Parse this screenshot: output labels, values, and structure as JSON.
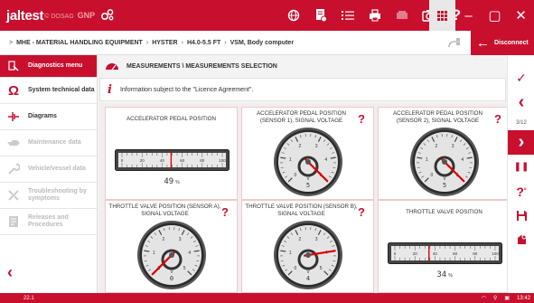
{
  "app": {
    "logo": "jaltest",
    "logo_sub": "© DOSAG",
    "logo_ext": "GNP"
  },
  "toolbar": {
    "icons": [
      "globe-icon",
      "report-icon",
      "list-icon",
      "print-icon",
      "printer-icon",
      "camera-icon",
      "help-icon"
    ],
    "window_grid": "apps-grid-icon",
    "minimize": "–",
    "maximize": "▢",
    "close": "✕"
  },
  "breadcrumb": {
    "items": [
      "MHE - MATERIAL HANDLING EQUIPMENT",
      "HYSTER",
      "H4.0-5.5 FT",
      "VSM, Body computer"
    ],
    "separator": "›",
    "home": ">"
  },
  "disconnect": {
    "label": "Disconnect",
    "arrow": "←"
  },
  "sidebar": {
    "items": [
      {
        "label": "Diagnostics menu",
        "icon": "diagnostics-icon",
        "state": "active"
      },
      {
        "label": "System technical data",
        "icon": "ohm-icon",
        "state": "normal"
      },
      {
        "label": "Diagrams",
        "icon": "diagram-icon",
        "state": "normal"
      },
      {
        "label": "Maintenance data",
        "icon": "oil-can-icon",
        "state": "disabled"
      },
      {
        "label": "Vehicle/vessel data",
        "icon": "wrench-icon",
        "state": "disabled"
      },
      {
        "label": "Troubleshooting by symptoms",
        "icon": "tools-icon",
        "state": "disabled"
      },
      {
        "label": "Releases and Procedures",
        "icon": "document-icon",
        "state": "disabled"
      }
    ],
    "back": "‹"
  },
  "section": {
    "title": "MEASUREMENTS \\ MEASUREMENTS SELECTION",
    "info": "Information subject to the \"Licence Agreement\".",
    "info_icon": "i"
  },
  "panels": [
    {
      "title": "ACCELERATOR PEDAL POSITION",
      "type": "linear",
      "value": "49",
      "unit": "%",
      "level": 49,
      "help": false,
      "ticks": [
        "0",
        "20",
        "40",
        "60",
        "80",
        "100"
      ]
    },
    {
      "title": "ACCELERATOR PEDAL POSITION (SENSOR 1), SIGNAL VOLTAGE",
      "type": "round",
      "value": "5",
      "unit": "V",
      "level": 5,
      "max": 5,
      "help": true,
      "ticks": [
        "0",
        "1",
        "2",
        "3",
        "4",
        "5"
      ]
    },
    {
      "title": "ACCELERATOR PEDAL POSITION (SENSOR 2), SIGNAL VOLTAGE",
      "type": "round",
      "value": "5",
      "unit": "V",
      "level": 5,
      "max": 5,
      "help": true,
      "ticks": [
        "0",
        "1",
        "2",
        "3",
        "4",
        "5"
      ]
    },
    {
      "title": "THROTTLE VALVE POSITION (SENSOR A), SIGNAL VOLTAGE",
      "type": "round",
      "value": "0",
      "unit": "V",
      "level": 0,
      "max": 5,
      "help": true,
      "ticks": [
        "0",
        "1",
        "2",
        "3",
        "4",
        "5"
      ]
    },
    {
      "title": "THROTTLE VALVE POSITION (SENSOR B), SIGNAL VOLTAGE",
      "type": "round",
      "value": "4",
      "unit": "V",
      "level": 4,
      "max": 5,
      "help": true,
      "ticks": [
        "0",
        "1",
        "2",
        "3",
        "4",
        "5"
      ]
    },
    {
      "title": "THROTTLE VALVE POSITION",
      "type": "linear",
      "value": "34",
      "unit": "%",
      "level": 34,
      "help": false,
      "ticks": [
        "0",
        "20",
        "40",
        "60",
        "80",
        "100"
      ]
    }
  ],
  "help_mark": "?",
  "right_toolbar": {
    "accept": "✓",
    "prev": "‹",
    "counter": "3/12",
    "next": "›",
    "pause": "❚❚",
    "help": "?",
    "save": "save-icon",
    "record": "record-icon"
  },
  "status": {
    "version": "22.1",
    "time": "13:42"
  },
  "colors": {
    "brand": "#c8102e",
    "needle": "#e00000"
  }
}
